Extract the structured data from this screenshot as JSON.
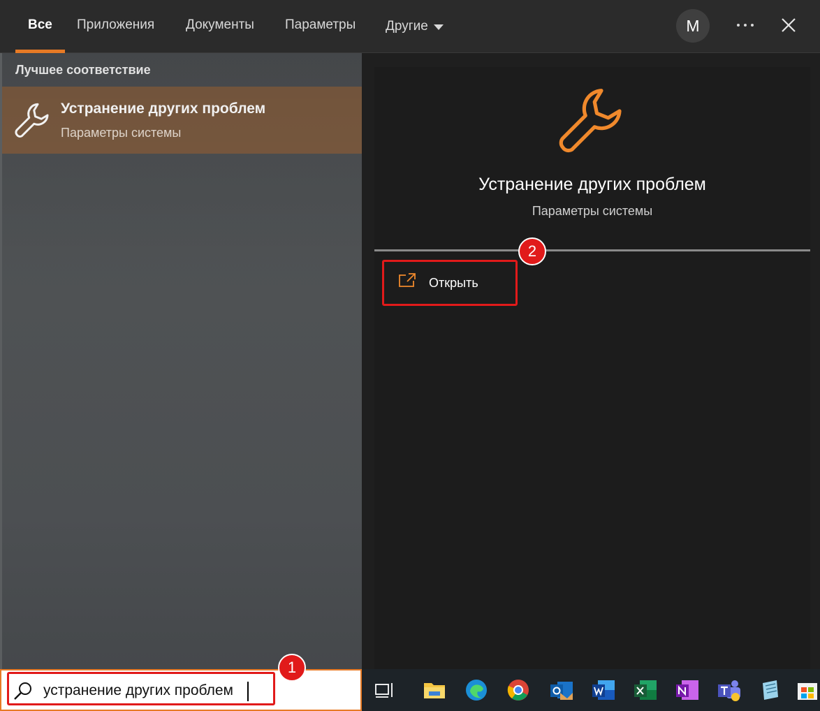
{
  "nav": {
    "tabs": [
      {
        "label": "Все",
        "active": true
      },
      {
        "label": "Приложения"
      },
      {
        "label": "Документы"
      },
      {
        "label": "Параметры"
      },
      {
        "label": "Другие"
      }
    ],
    "avatar_initial": "M",
    "more_icon": "ellipsis-icon",
    "close_icon": "close-icon"
  },
  "results": {
    "section_title": "Лучшее соответствие",
    "best_match": {
      "title": "Устранение других проблем",
      "subtitle": "Параметры системы",
      "icon": "wrench-icon"
    }
  },
  "details": {
    "title": "Устранение других проблем",
    "subtitle": "Параметры системы",
    "icon": "wrench-icon",
    "actions": [
      {
        "label": "Открыть",
        "icon": "open-external-icon"
      }
    ]
  },
  "annotations": {
    "badge_1": "1",
    "badge_2": "2"
  },
  "search": {
    "value": "устранение других проблем",
    "icon": "search-icon"
  },
  "taskbar": {
    "icons": [
      "task-view-icon",
      "file-explorer-icon",
      "edge-icon",
      "chrome-icon",
      "outlook-icon",
      "word-icon",
      "excel-icon",
      "onenote-icon",
      "teams-icon",
      "notepad-icon",
      "store-icon"
    ]
  },
  "colors": {
    "accent": "#e77a25",
    "selection": "#7a5a40",
    "highlight": "#e11a1a"
  }
}
